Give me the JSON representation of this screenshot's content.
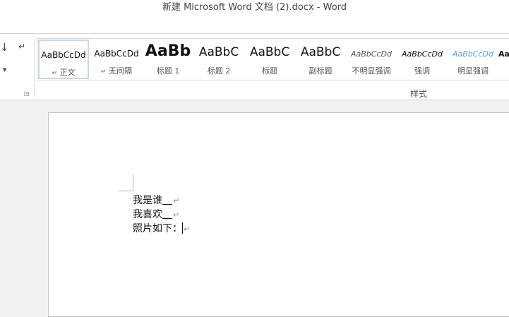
{
  "window": {
    "title": "新建 Microsoft Word 文档 (2).docx - Word"
  },
  "ribbon": {
    "paragraph_icons": [
      "sort-icon",
      "show-marks-icon",
      "dropdown-arrow-icon",
      "dialog-launcher-icon"
    ],
    "styles_group_label": "样式",
    "styles": [
      {
        "sample": "AaBbCcDd",
        "label": "正文",
        "mark": "↵",
        "selected": true
      },
      {
        "sample": "AaBbCcDd",
        "label": "无间隔",
        "mark": "↵"
      },
      {
        "sample": "AaBb",
        "label": "标题 1"
      },
      {
        "sample": "AaBbC",
        "label": "标题 2"
      },
      {
        "sample": "AaBbC",
        "label": "标题"
      },
      {
        "sample": "AaBbC",
        "label": "副标题"
      },
      {
        "sample": "AaBbCcDd",
        "label": "不明显强调"
      },
      {
        "sample": "AaBbCcDd",
        "label": "强调"
      },
      {
        "sample": "AaBbCcDd",
        "label": "明显强调"
      },
      {
        "sample": "Aa",
        "label": ""
      }
    ],
    "colors": {
      "subtle_emphasis": "#555555",
      "intense_emphasis": "#5b9bd5",
      "selected_border": "#c5d7ef"
    }
  },
  "document": {
    "lines": [
      {
        "text": "我是谁",
        "blank": true
      },
      {
        "text": "我喜欢",
        "blank": true
      },
      {
        "text": "照片如下：",
        "blank": false,
        "caret": true
      }
    ],
    "paragraph_mark": "↵"
  }
}
